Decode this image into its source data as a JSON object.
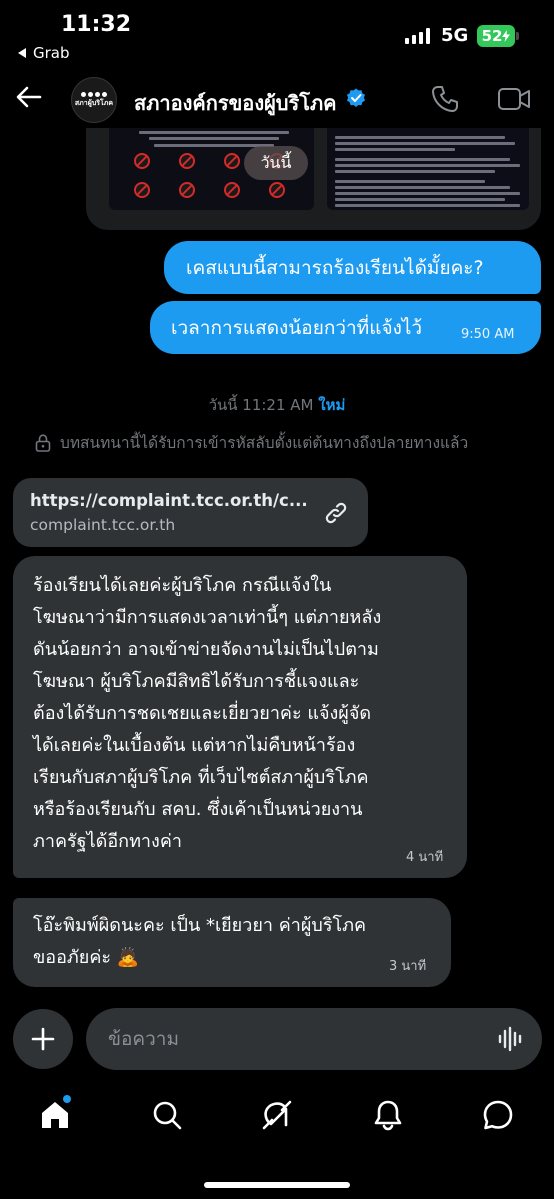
{
  "status_bar": {
    "time": "11:32",
    "back_app": "Grab",
    "network": "5G",
    "battery": "52"
  },
  "header": {
    "contact_name": "สภาองค์กรของผู้บริโภค",
    "avatar_label": "สภาผู้บริโภค",
    "accent_color": "#1d9bf0"
  },
  "conversation": {
    "image_overlay_label": "วันนี้",
    "sent_messages": [
      {
        "text": "เคสแบบนี้สามารถร้องเรียนได้มั้ยคะ?"
      },
      {
        "text": "เวลาการแสดงน้อยกว่าที่แจ้งไว้",
        "time": "9:50 AM"
      }
    ],
    "separator": {
      "date": "วันนี้ 11:21 AM",
      "new_label": "ใหม่"
    },
    "encryption_notice": "บทสนทนานี้ได้รับการเข้ารหัสลับตั้งแต่ต้นทางถึงปลายทางแล้ว",
    "link_preview": {
      "url": "https://complaint.tcc.or.th/c...",
      "domain": "complaint.tcc.or.th"
    },
    "received_messages": [
      {
        "text": "ร้องเรียนได้เลยค่ะผู้บริโภค กรณีแจ้งใน\nโฆษณาว่ามีการแสดงเวลาเท่านี้ๆ แต่ภายหลัง\nดันน้อยกว่า อาจเข้าข่ายจัดงานไม่เป็นไปตาม\nโฆษณา ผู้บริโภคมีสิทธิได้รับการชี้แจงและ\nต้องได้รับการชดเชยและเยี่ยวยาค่ะ แจ้งผู้จัด\nได้เลยค่ะในเบื้องต้น แต่หากไม่คืบหน้าร้อง\nเรียนกับสภาผู้บริโภค ที่เว็บไซต์สภาผู้บริโภค\nหรือร้องเรียนกับ สคบ. ซึ่งเค้าเป็นหน่วยงาน\nภาครัฐได้อีกทางค่า",
        "time": "4 นาที"
      },
      {
        "text": "โอ๊ะพิมพ์ผิดนะคะ เป็น *เยียวยา ค่าผู้บริโภค\nขออภัยค่ะ 🙇",
        "time": "3 นาที"
      }
    ]
  },
  "composer": {
    "placeholder": "ข้อความ"
  },
  "bottom_nav": [
    "home-icon",
    "search-icon",
    "grok-icon",
    "notifications-icon",
    "messages-icon"
  ]
}
